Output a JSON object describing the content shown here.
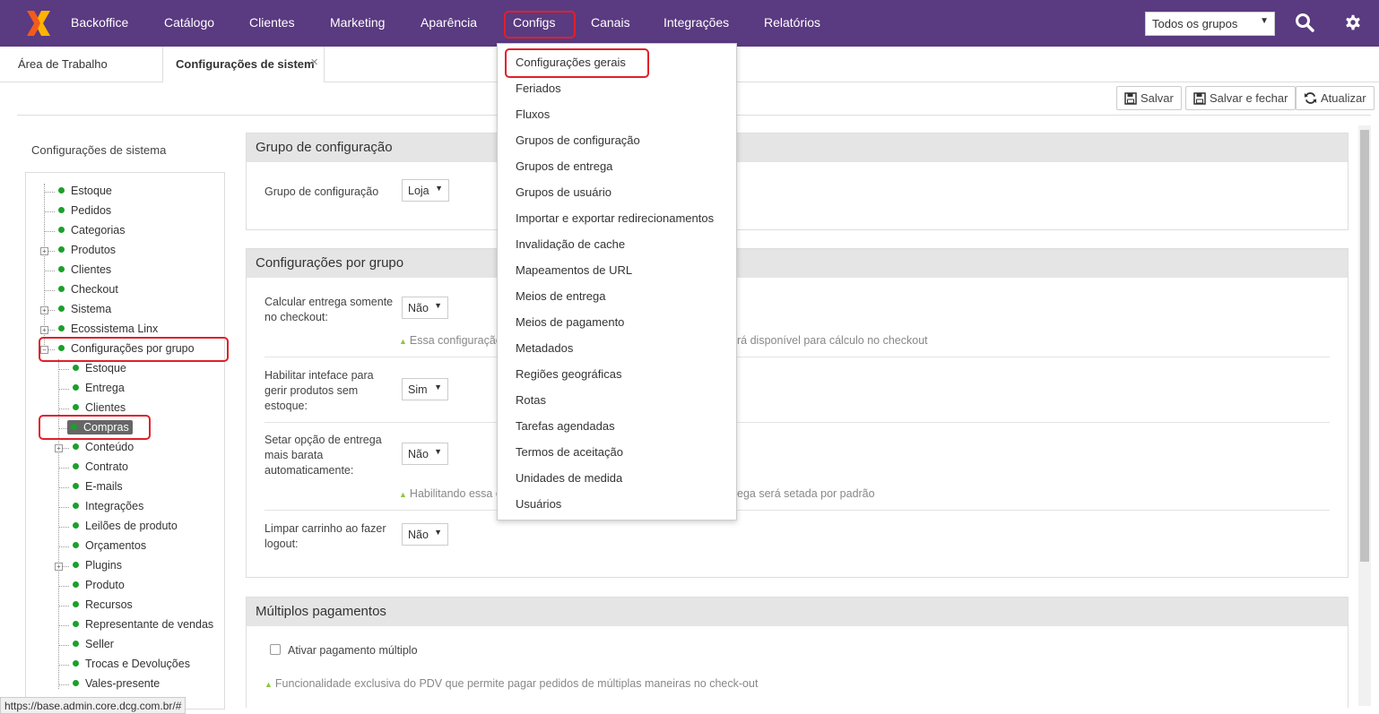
{
  "nav": {
    "items": [
      "Backoffice",
      "Catálogo",
      "Clientes",
      "Marketing",
      "Aparência",
      "Configs",
      "Canais",
      "Integrações",
      "Relatórios"
    ],
    "group_select": "Todos os grupos",
    "icons": [
      "search-icon",
      "gear-icon"
    ]
  },
  "tabs": {
    "home": "Área de Trabalho",
    "active": "Configurações de sistem",
    "close": "×"
  },
  "toolbar": {
    "save": "Salvar",
    "save_close": "Salvar e fechar",
    "refresh": "Atualizar"
  },
  "tree": {
    "title": "Configurações de sistema",
    "items": [
      "Estoque",
      "Pedidos",
      "Categorias",
      "Produtos",
      "Clientes",
      "Checkout",
      "Sistema",
      "Ecossistema Linx",
      "Configurações por grupo"
    ],
    "children": [
      "Estoque",
      "Entrega",
      "Clientes",
      "Compras",
      "Conteúdo",
      "Contrato",
      "E-mails",
      "Integrações",
      "Leilões de produto",
      "Orçamentos",
      "Plugins",
      "Produto",
      "Recursos",
      "Representante de vendas",
      "Seller",
      "Trocas e Devoluções",
      "Vales-presente"
    ]
  },
  "panels": {
    "group": {
      "title": "Grupo de configuração",
      "label": "Grupo de configuração",
      "value": "Loja"
    },
    "by_group": {
      "title": "Configurações por grupo",
      "f1_label": "Calcular entrega somente no checkout:",
      "f1_value": "Não",
      "f1_hint_a": "Essa configuração,",
      "f1_hint_b": "rá disponível para cálculo no checkout",
      "f2_label": "Habilitar inteface para gerir produtos sem estoque:",
      "f2_value": "Sim",
      "f3_label": "Setar opção de entrega mais barata automaticamente:",
      "f3_value": "Não",
      "f3_hint_a": "Habilitando essa o",
      "f3_hint_b": "ega será setada por padrão",
      "f4_label": "Limpar carrinho ao fazer logout:",
      "f4_value": "Não"
    },
    "multi": {
      "title": "Múltiplos pagamentos",
      "checkbox_label": "Ativar pagamento múltiplo",
      "hint": "Funcionalidade exclusiva do PDV que permite pagar pedidos de múltiplas maneiras no check-out"
    }
  },
  "dropdown": {
    "items": [
      "Configurações gerais",
      "Feriados",
      "Fluxos",
      "Grupos de configuração",
      "Grupos de entrega",
      "Grupos de usuário",
      "Importar e exportar redirecionamentos",
      "Invalidação de cache",
      "Mapeamentos de URL",
      "Meios de entrega",
      "Meios de pagamento",
      "Metadados",
      "Regiões geográficas",
      "Rotas",
      "Tarefas agendadas",
      "Termos de aceitação",
      "Unidades de medida",
      "Usuários"
    ]
  },
  "status_url": "https://base.admin.core.dcg.com.br/#",
  "colors": {
    "nav_bg": "#5a3a80",
    "highlight": "#e0202a",
    "tree_dot": "#1aa02a",
    "hint_marker": "#8cc63f",
    "panel_head": "#e5e5e5"
  }
}
